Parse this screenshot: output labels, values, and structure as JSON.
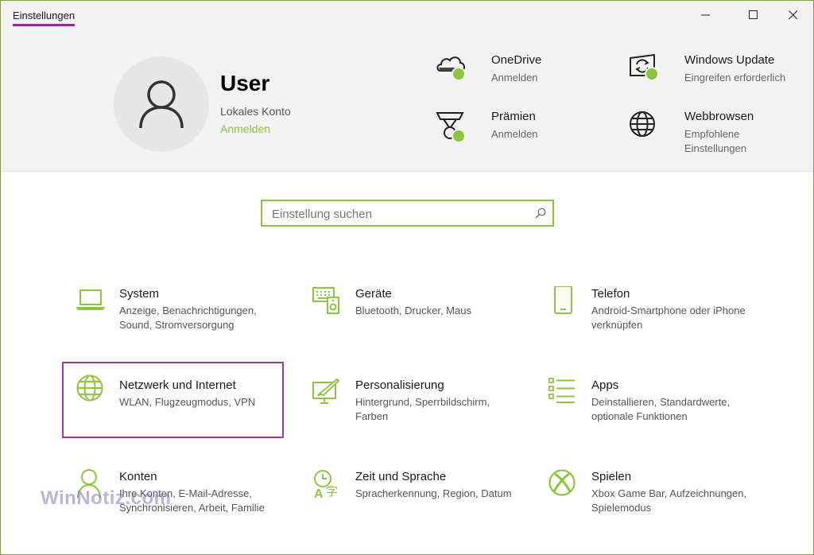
{
  "window": {
    "title": "Einstellungen",
    "accent_color": "#8cc63f",
    "highlight_color": "#9a3aa0"
  },
  "caption_buttons": [
    "minimize-icon",
    "maximize-icon",
    "close-icon"
  ],
  "account": {
    "name": "User",
    "type": "Lokales Konto",
    "sign_in": "Anmelden"
  },
  "quick_links": [
    {
      "icon": "onedrive-icon",
      "title": "OneDrive",
      "subtitle": "Anmelden"
    },
    {
      "icon": "windows-update-icon",
      "title": "Windows Update",
      "subtitle": "Eingreifen erforderlich"
    },
    {
      "icon": "rewards-icon",
      "title": "Prämien",
      "subtitle": "Anmelden"
    },
    {
      "icon": "globe-icon",
      "title": "Webbrowsen",
      "subtitle": "Empfohlene Einstellungen"
    }
  ],
  "search": {
    "placeholder": "Einstellung suchen",
    "value": ""
  },
  "categories": [
    {
      "icon": "laptop-icon",
      "title": "System",
      "subtitle": "Anzeige, Benachrichtigungen, Sound, Stromversorgung"
    },
    {
      "icon": "keyboard-speaker-icon",
      "title": "Geräte",
      "subtitle": "Bluetooth, Drucker, Maus"
    },
    {
      "icon": "phone-icon",
      "title": "Telefon",
      "subtitle": "Android-Smartphone oder iPhone verknüpfen"
    },
    {
      "icon": "globe-icon",
      "title": "Netzwerk und Internet",
      "subtitle": "WLAN, Flugzeugmodus, VPN",
      "highlighted": true
    },
    {
      "icon": "paintbrush-icon",
      "title": "Personalisierung",
      "subtitle": "Hintergrund, Sperrbildschirm, Farben"
    },
    {
      "icon": "apps-list-icon",
      "title": "Apps",
      "subtitle": "Deinstallieren, Standardwerte, optionale Funktionen"
    },
    {
      "icon": "person-icon",
      "title": "Konten",
      "subtitle": "Ihre Konten, E-Mail-Adresse, Synchronisieren, Arbeit, Familie"
    },
    {
      "icon": "time-language-icon",
      "title": "Zeit und Sprache",
      "subtitle": "Spracherkennung, Region, Datum"
    },
    {
      "icon": "xbox-icon",
      "title": "Spielen",
      "subtitle": "Xbox Game Bar, Aufzeichnungen, Spielemodus"
    }
  ],
  "watermark": "WinNotiz.com"
}
